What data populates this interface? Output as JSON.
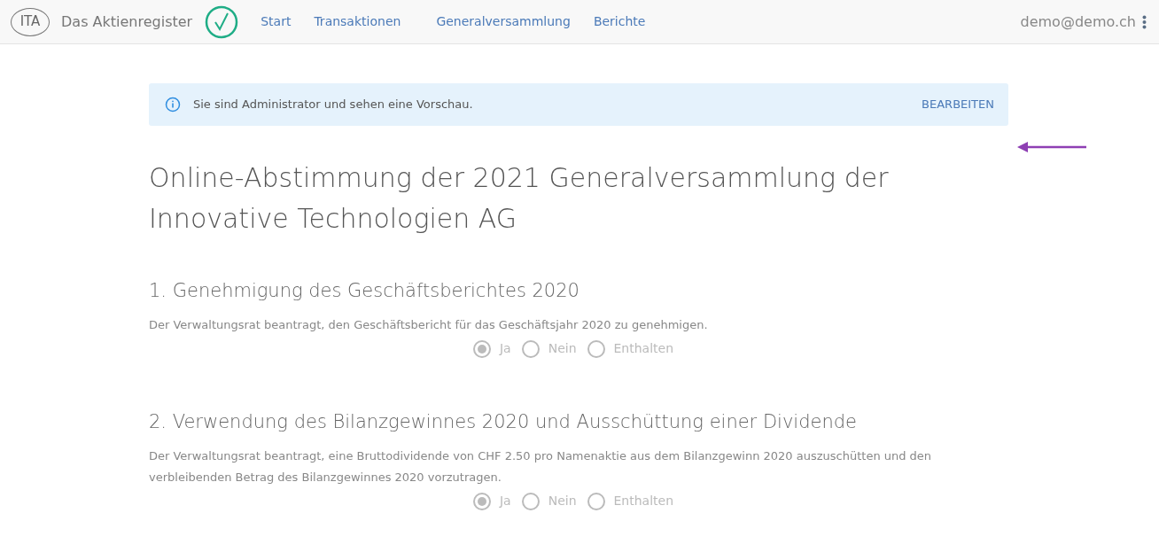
{
  "navbar": {
    "logo": "ITA",
    "brand": "Das Aktienregister",
    "links": [
      "Start",
      "Transaktionen",
      "Generalversammlung",
      "Berichte"
    ],
    "user": "demo@demo.ch"
  },
  "alert": {
    "message": "Sie sind Administrator und sehen eine Vorschau.",
    "action": "BEARBEITEN"
  },
  "title": "Online-Abstimmung der 2021 Generalversammlung der Innovative Technologien AG",
  "items": [
    {
      "heading": "1. Genehmigung des Geschäftsberichtes 2020",
      "text": "Der Verwaltungsrat beantragt, den Geschäftsbericht für das Geschäftsjahr 2020 zu genehmigen.",
      "disabled": true,
      "options": [
        {
          "label": "Ja",
          "selected": true
        },
        {
          "label": "Nein",
          "selected": false
        },
        {
          "label": "Enthalten",
          "selected": false
        }
      ]
    },
    {
      "heading": "2. Verwendung des Bilanzgewinnes 2020 und Ausschüttung einer Dividende",
      "text": "Der Verwaltungsrat beantragt, eine Bruttodividende von CHF 2.50 pro Namenaktie aus dem Bilanzgewinn 2020 auszuschütten und den verbleibenden Betrag des Bilanzgewinnes 2020 vorzutragen.",
      "disabled": true,
      "options": [
        {
          "label": "Ja",
          "selected": true
        },
        {
          "label": "Nein",
          "selected": false
        },
        {
          "label": "Enthalten",
          "selected": false
        }
      ]
    }
  ]
}
